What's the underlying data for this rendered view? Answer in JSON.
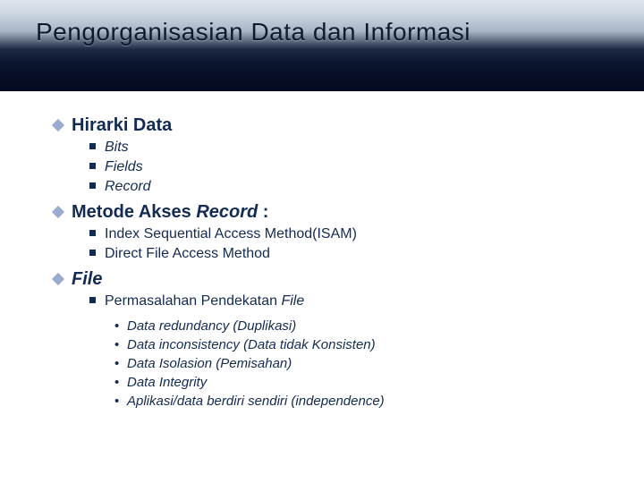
{
  "title": "Pengorganisasian Data dan Informasi",
  "sections": [
    {
      "heading": "Hirarki Data",
      "items": [
        "Bits",
        "Fields",
        "Record"
      ]
    },
    {
      "heading_plain": "Metode Akses  ",
      "heading_italic": "Record ",
      "heading_after": ":",
      "items": [
        "Index Sequential Access Method(ISAM)",
        "Direct File Access Method"
      ]
    },
    {
      "heading_italic_only": "File",
      "items_complex": {
        "label_plain": "Permasalahan Pendekatan ",
        "label_italic": "File",
        "sub": [
          "Data redundancy (Duplikasi)",
          "Data inconsistency (Data tidak Konsisten)",
          "Data Isolasion (Pemisahan)",
          "Data Integrity",
          "Aplikasi/data berdiri sendiri (independence)"
        ]
      }
    }
  ]
}
